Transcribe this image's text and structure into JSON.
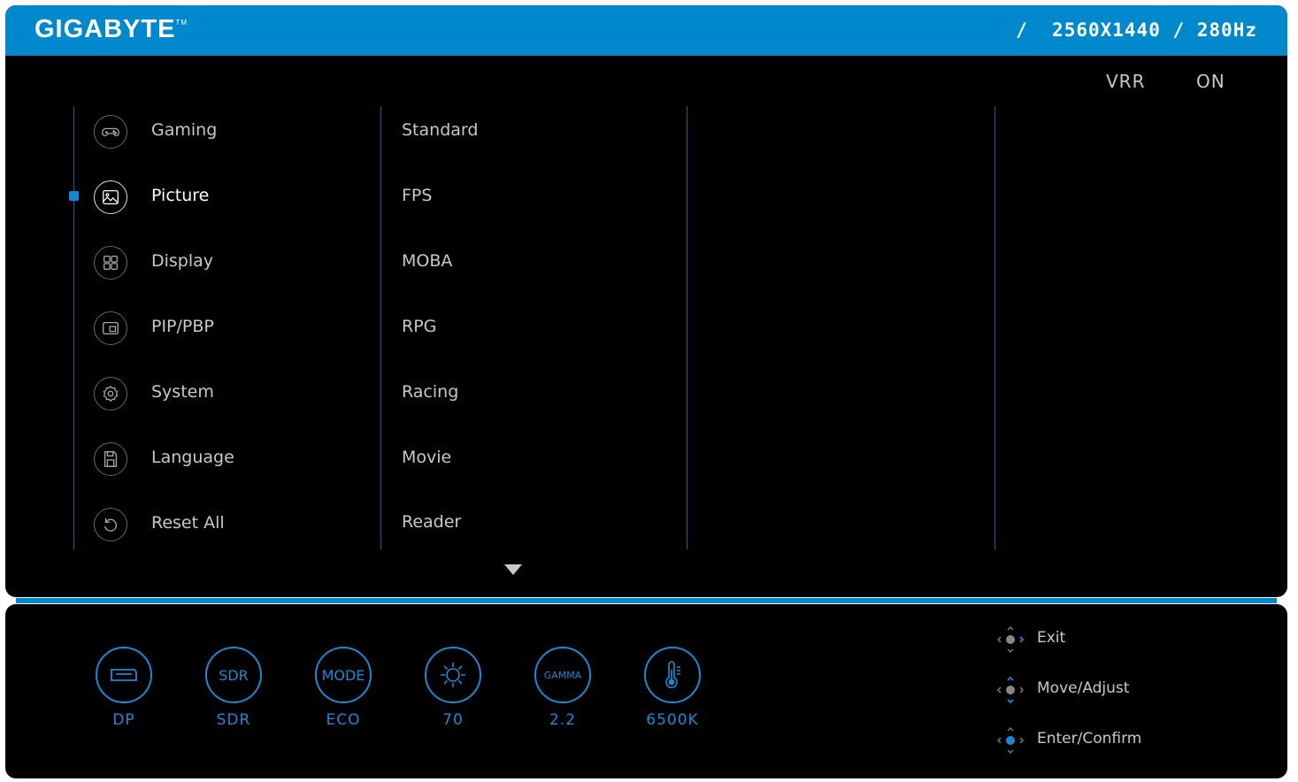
{
  "header": {
    "brand": "GIGABYTE",
    "trademark": "TM",
    "resolution_info": "/  2560X1440 / 280Hz"
  },
  "vrr": {
    "label": "VRR",
    "value": "ON"
  },
  "menu": {
    "items": [
      {
        "label": "Gaming",
        "icon": "gamepad-icon"
      },
      {
        "label": "Picture",
        "icon": "picture-icon",
        "active": true
      },
      {
        "label": "Display",
        "icon": "grid-icon"
      },
      {
        "label": "PIP/PBP",
        "icon": "pip-icon"
      },
      {
        "label": "System",
        "icon": "gear-icon"
      },
      {
        "label": "Language",
        "icon": "save-icon"
      },
      {
        "label": "Reset All",
        "icon": "reset-icon"
      }
    ]
  },
  "submenu": {
    "items": [
      "Standard",
      "FPS",
      "MOBA",
      "RPG",
      "Racing",
      "Movie",
      "Reader"
    ]
  },
  "status": {
    "items": [
      {
        "icon": "displayport-icon",
        "icon_text": "",
        "value": "DP"
      },
      {
        "icon": "sdr-icon",
        "icon_text": "SDR",
        "value": "SDR"
      },
      {
        "icon": "mode-icon",
        "icon_text": "MODE",
        "value": "ECO"
      },
      {
        "icon": "brightness-icon",
        "icon_text": "",
        "value": "70"
      },
      {
        "icon": "gamma-icon",
        "icon_text": "GAMMA",
        "value": "2.2"
      },
      {
        "icon": "thermometer-icon",
        "icon_text": "",
        "value": "6500K"
      }
    ]
  },
  "hints": {
    "exit": "Exit",
    "move_adjust": "Move/Adjust",
    "enter_confirm": "Enter/Confirm"
  },
  "colors": {
    "accent_blue": "#0088cc",
    "status_blue": "#1a8ad4",
    "divider_blue": "#1a5f95",
    "text_gray": "#c8c8c8"
  }
}
